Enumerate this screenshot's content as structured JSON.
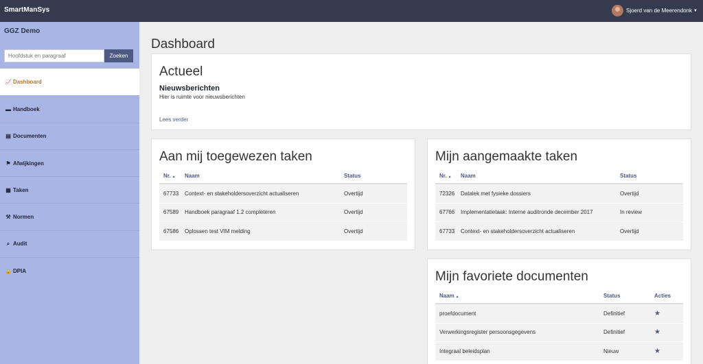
{
  "header": {
    "brand": "SmartManSys",
    "user_name": "Sjoerd van de Meerendonk"
  },
  "sidebar": {
    "org": "GGZ Demo",
    "search_placeholder": "Hoofdstuk en paragraaf",
    "search_button": "Zoeken",
    "items": [
      {
        "label": "Dashboard",
        "icon": "chart-line-icon",
        "active": true
      },
      {
        "label": "Handboek",
        "icon": "book-icon"
      },
      {
        "label": "Documenten",
        "icon": "document-icon"
      },
      {
        "label": "Afwijkingen",
        "icon": "flag-icon"
      },
      {
        "label": "Taken",
        "icon": "calendar-icon"
      },
      {
        "label": "Normen",
        "icon": "hammer-icon"
      },
      {
        "label": "Audit",
        "icon": "search-icon"
      },
      {
        "label": "DPIA",
        "icon": "lock-icon"
      }
    ]
  },
  "main": {
    "title": "Dashboard",
    "actueel": {
      "title": "Actueel",
      "news_heading": "Nieuwsberichten",
      "news_text": "Hier is ruimte voor nieuwsberichten",
      "read_more": "Lees verder"
    },
    "assigned_tasks": {
      "title": "Aan mij toegewezen taken",
      "headers": {
        "nr": "Nr.",
        "naam": "Naam",
        "status": "Status"
      },
      "rows": [
        {
          "nr": "67733",
          "naam": "Context- en stakeholdersoverzicht actualiseren",
          "status": "Overtijd"
        },
        {
          "nr": "67589",
          "naam": "Handboek paragraaf 1.2 completeren",
          "status": "Overtijd"
        },
        {
          "nr": "67586",
          "naam": "Oplossen test VIM melding",
          "status": "Overtijd"
        }
      ]
    },
    "created_tasks": {
      "title": "Mijn aangemaakte taken",
      "headers": {
        "nr": "Nr.",
        "naam": "Naam",
        "status": "Status"
      },
      "rows": [
        {
          "nr": "72326",
          "naam": "Datalek met fysieke dossiers",
          "status": "Overtijd"
        },
        {
          "nr": "67766",
          "naam": "Implementatietaak: Interne auditronde december 2017",
          "status": "In review"
        },
        {
          "nr": "67733",
          "naam": "Context- en stakeholdersoverzicht actualiseren",
          "status": "Overtijd"
        }
      ]
    },
    "favorite_docs": {
      "title": "Mijn favoriete documenten",
      "headers": {
        "naam": "Naam",
        "status": "Status",
        "acties": "Acties"
      },
      "rows": [
        {
          "naam": "proefdocument",
          "status": "Definitief"
        },
        {
          "naam": "Verwerkingsregister persoonsgegevens",
          "status": "Definitief"
        },
        {
          "naam": "Integraal beleidsplan",
          "status": "Nieuw"
        }
      ]
    }
  },
  "colors": {
    "topbar": "#343b4f",
    "sidebar": "#a9b6e5",
    "accent": "#4c5a82",
    "active_text": "#b5762a"
  }
}
